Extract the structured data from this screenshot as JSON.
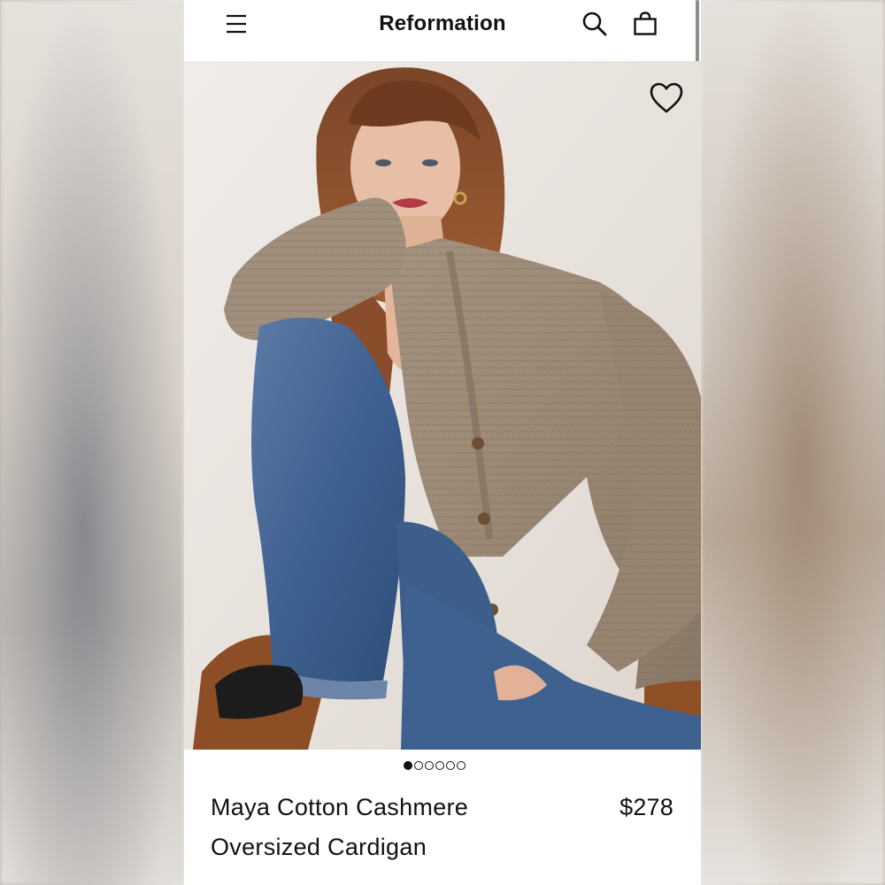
{
  "header": {
    "brand": "Reformation",
    "icons": {
      "menu": "hamburger-menu-icon",
      "search": "search-icon",
      "bag": "shopping-bag-icon"
    }
  },
  "product": {
    "name": "Maya Cotton Cashmere Oversized Cardigan",
    "price": "$278",
    "wishlist_icon": "heart-icon",
    "carousel": {
      "total": 6,
      "active_index": 0
    }
  },
  "colors": {
    "header_bg": "#ffffff",
    "text": "#111111",
    "sweater": "#9b8a78",
    "denim": "#3f5f89",
    "background": "#ebe6e1",
    "chair": "#9d5a2c"
  }
}
